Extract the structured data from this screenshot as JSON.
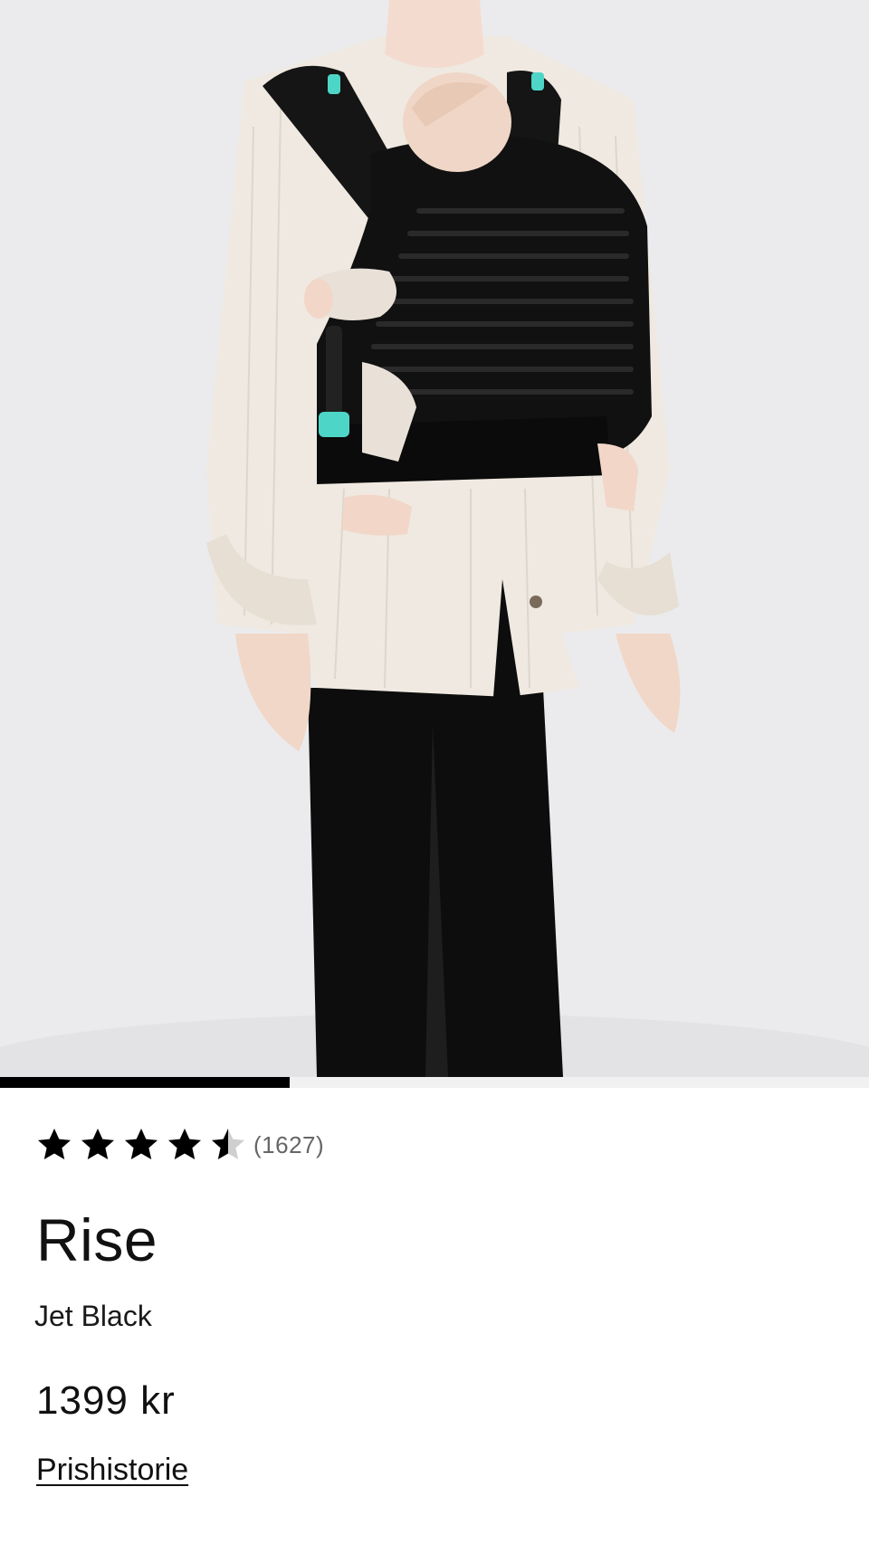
{
  "product": {
    "image_alt": "Rise baby carrier, Jet Black, worn by a parent with a baby",
    "carousel_progress": 0.333,
    "rating": {
      "value": 4.5,
      "max": 5,
      "count_label": "(1627)"
    },
    "title": "Rise",
    "variant": "Jet Black",
    "price": "1399 kr",
    "price_history_link": "Prishistorie"
  },
  "colors": {
    "accent": "#4dd6c8",
    "carrier": "#111111",
    "shirt": "#efe9e1",
    "star": "#000000"
  }
}
